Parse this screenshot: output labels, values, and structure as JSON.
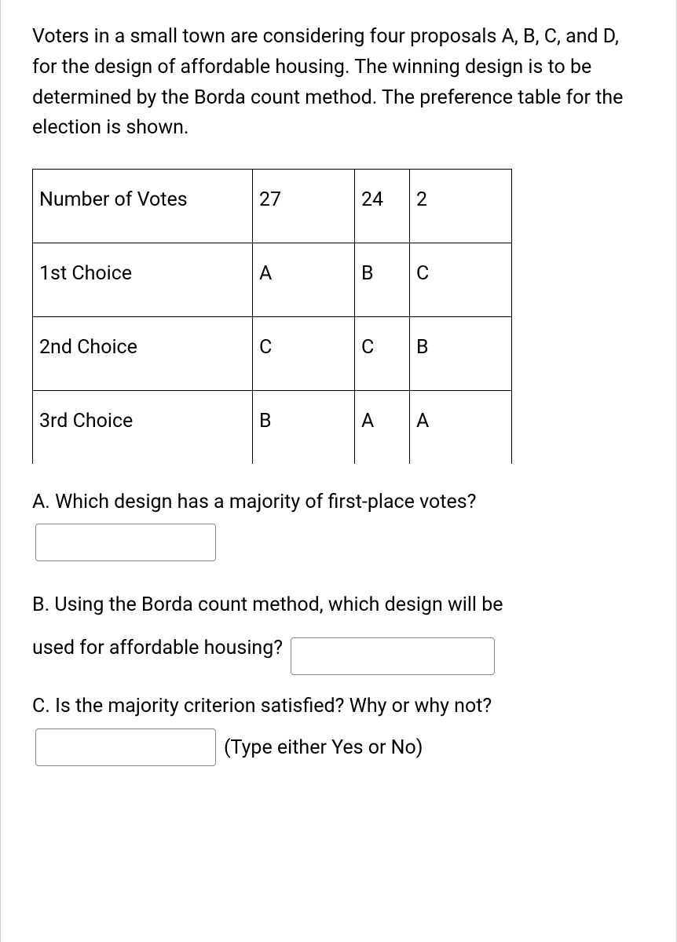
{
  "problemText": "Voters in a small town are considering four proposals A, B, C, and D, for the design of affordable housing. The winning design is to be determined by the Borda count method. The preference table for the election is shown.",
  "table": {
    "headerRow": {
      "label": "Number of Votes",
      "c1": "27",
      "c2": "24",
      "c3": "2"
    },
    "row1": {
      "label": "1st Choice",
      "c1": "A",
      "c2": "B",
      "c3": "C"
    },
    "row2": {
      "label": "2nd Choice",
      "c1": "C",
      "c2": "C",
      "c3": "B"
    },
    "row3": {
      "label": "3rd Choice",
      "c1": "B",
      "c2": "A",
      "c3": "A"
    }
  },
  "questionA": "A. Which design has a majority of first-place votes?",
  "questionB_part1": "B. Using the Borda count method, which design will be",
  "questionB_part2": "used for affordable housing?",
  "questionC": "C. Is the majority criterion satisfied? Why or why not?",
  "questionC_hint": "(Type either Yes or No)",
  "answers": {
    "a": "",
    "b": "",
    "c": ""
  }
}
